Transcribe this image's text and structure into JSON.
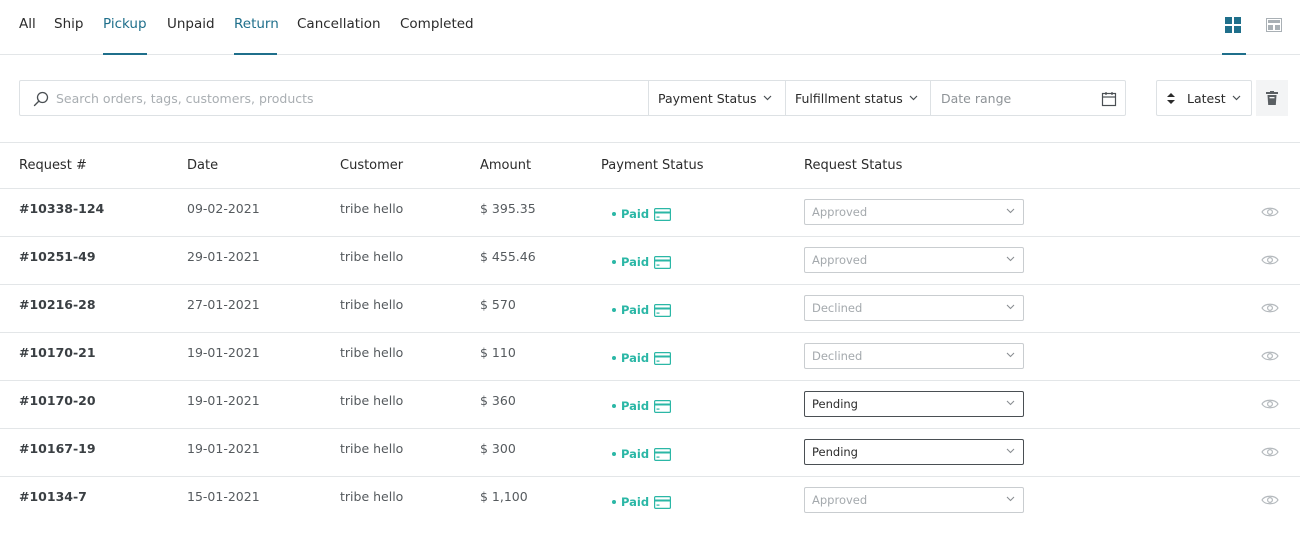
{
  "tabs": [
    {
      "label": "All",
      "active": false
    },
    {
      "label": "Ship",
      "active": false
    },
    {
      "label": "Pickup",
      "active": true
    },
    {
      "label": "Unpaid",
      "active": false
    },
    {
      "label": "Return",
      "active": true
    },
    {
      "label": "Cancellation",
      "active": false
    },
    {
      "label": "Completed",
      "active": false
    }
  ],
  "view_toggles": [
    {
      "icon": "grid-view-icon",
      "active": true
    },
    {
      "icon": "table-view-icon",
      "active": false
    }
  ],
  "filters": {
    "search_placeholder": "Search orders, tags, customers, products",
    "payment_status_label": "Payment Status",
    "fulfillment_status_label": "Fulfillment status",
    "date_range_placeholder": "Date range",
    "sort_label": "Latest"
  },
  "table": {
    "headers": [
      "Request #",
      "Date",
      "Customer",
      "Amount",
      "Payment Status",
      "Request Status"
    ],
    "rows": [
      {
        "request": "#10338-124",
        "date": "09-02-2021",
        "customer": "tribe hello",
        "amount": "$ 395.35",
        "payment": "Paid",
        "status": "Approved",
        "status_kind": "muted"
      },
      {
        "request": "#10251-49",
        "date": "29-01-2021",
        "customer": "tribe hello",
        "amount": "$ 455.46",
        "payment": "Paid",
        "status": "Approved",
        "status_kind": "muted"
      },
      {
        "request": "#10216-28",
        "date": "27-01-2021",
        "customer": "tribe hello",
        "amount": "$ 570",
        "payment": "Paid",
        "status": "Declined",
        "status_kind": "muted"
      },
      {
        "request": "#10170-21",
        "date": "19-01-2021",
        "customer": "tribe hello",
        "amount": "$ 110",
        "payment": "Paid",
        "status": "Declined",
        "status_kind": "muted"
      },
      {
        "request": "#10170-20",
        "date": "19-01-2021",
        "customer": "tribe hello",
        "amount": "$ 360",
        "payment": "Paid",
        "status": "Pending",
        "status_kind": "pending"
      },
      {
        "request": "#10167-19",
        "date": "19-01-2021",
        "customer": "tribe hello",
        "amount": "$ 300",
        "payment": "Paid",
        "status": "Pending",
        "status_kind": "pending"
      },
      {
        "request": "#10134-7",
        "date": "15-01-2021",
        "customer": "tribe hello",
        "amount": "$ 1,100",
        "payment": "Paid",
        "status": "Approved",
        "status_kind": "muted"
      }
    ]
  },
  "colors": {
    "accent": "#1f6f8b",
    "paid": "#2bb7a6",
    "border": "#e3e6e8"
  }
}
